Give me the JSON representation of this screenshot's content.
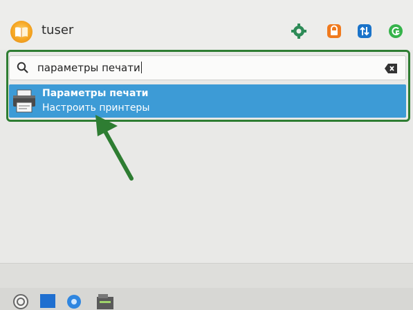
{
  "user": {
    "name": "tuser",
    "avatar_icon": "reader-avatar-icon"
  },
  "header_actions": [
    {
      "name": "settings-gear-icon",
      "color": "#2e8b57"
    },
    {
      "name": "lock-icon",
      "color": "#f07a1e"
    },
    {
      "name": "switch-user-icon",
      "color": "#1a73c9"
    },
    {
      "name": "logout-icon",
      "color": "#35b34a"
    }
  ],
  "search": {
    "value": "параметры печати"
  },
  "results": [
    {
      "title": "Параметры печати",
      "subtitle": "Настроить принтеры",
      "icon": "printer-icon"
    }
  ],
  "colors": {
    "highlight": "#3d9bd6",
    "annotation": "#2e7d32"
  },
  "taskbar": {
    "items": [
      "start-menu-icon",
      "show-desktop-icon",
      "browser-icon",
      "file-manager-icon"
    ]
  }
}
